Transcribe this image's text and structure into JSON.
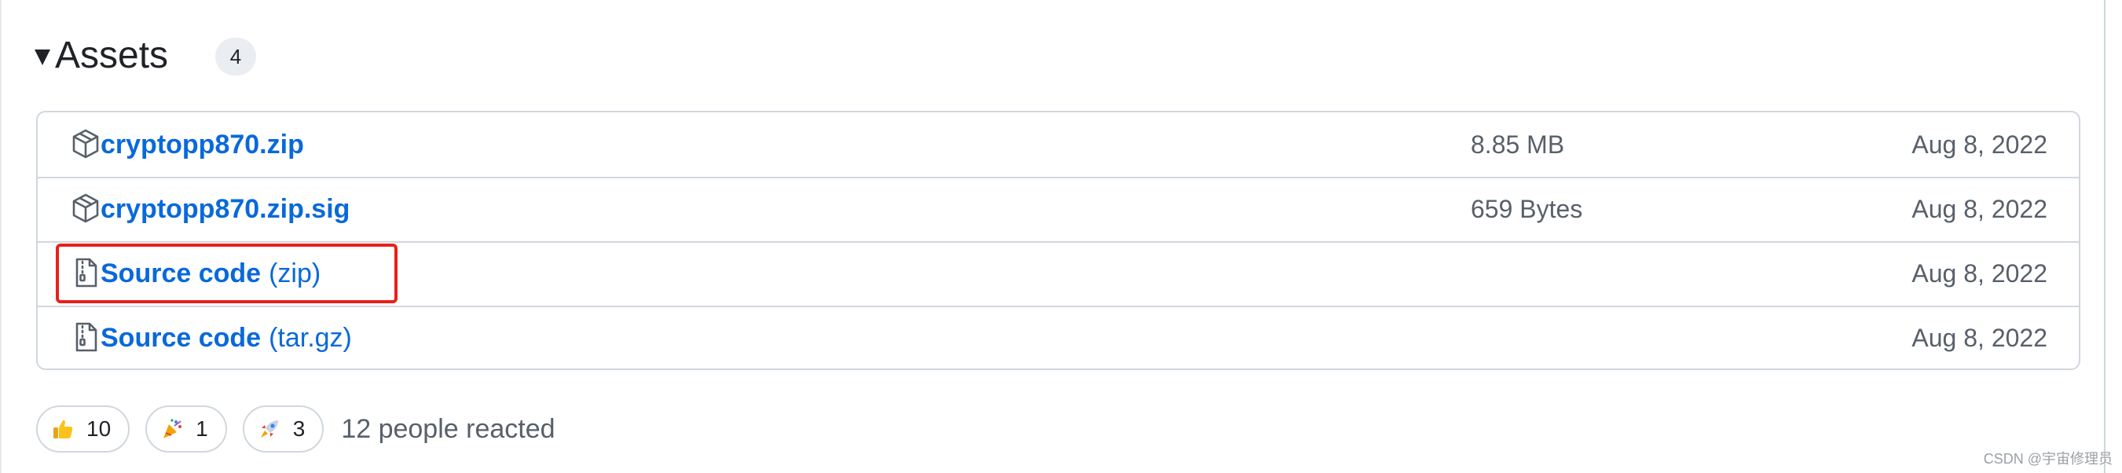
{
  "assets": {
    "title": "Assets",
    "count": "4",
    "rows": [
      {
        "icon": "package-icon",
        "name": "cryptopp870.zip",
        "ext": "",
        "size": "8.85 MB",
        "date": "Aug 8, 2022"
      },
      {
        "icon": "package-icon",
        "name": "cryptopp870.zip.sig",
        "ext": "",
        "size": "659 Bytes",
        "date": "Aug 8, 2022"
      },
      {
        "icon": "file-zip-icon",
        "name": "Source code",
        "ext": "(zip)",
        "size": "",
        "date": "Aug 8, 2022"
      },
      {
        "icon": "file-zip-icon",
        "name": "Source code",
        "ext": "(tar.gz)",
        "size": "",
        "date": "Aug 8, 2022"
      }
    ]
  },
  "reactions": {
    "items": [
      {
        "emoji": "thumbs-up-icon",
        "count": "10"
      },
      {
        "emoji": "party-popper-icon",
        "count": "1"
      },
      {
        "emoji": "rocket-icon",
        "count": "3"
      }
    ],
    "summary": "12 people reacted"
  },
  "annotation": {
    "highlighted_row": "Source code (zip)",
    "color": "#e8201a"
  },
  "colors": {
    "link": "#0969da",
    "muted": "#57606a",
    "border": "#d0d7de"
  },
  "watermark": "CSDN @宇宙修理员"
}
